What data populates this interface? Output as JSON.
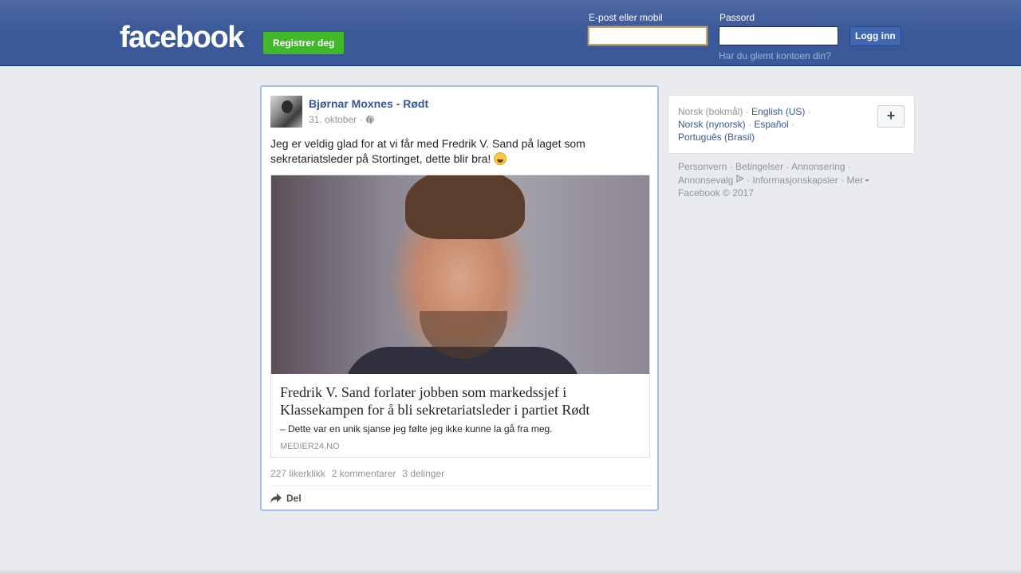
{
  "header": {
    "logo": "facebook",
    "register_label": "Registrer deg",
    "email_label": "E-post eller mobil",
    "email_value": "",
    "password_label": "Passord",
    "password_value": "",
    "login_label": "Logg inn",
    "forgot_label": "Har du glemt kontoen din?"
  },
  "post": {
    "author": "Bjørnar Moxnes - Rødt",
    "date": "31. oktober",
    "separator": "·",
    "text": "Jeg er veldig glad for at vi får med Fredrik V. Sand på laget som sekretariatsleder på Stortinget, dette blir bra!",
    "link": {
      "title": "Fredrik V. Sand forlater jobben som markedssjef i Klassekampen for å bli sekretariatsleder i partiet Rødt",
      "description": "– Dette var en unik sjanse jeg følte jeg ikke kunne la gå fra meg.",
      "domain": "MEDIER24.NO"
    },
    "likes": "227 likerklikk",
    "comments": "2 kommentarer",
    "shares": "3 delinger",
    "share_label": "Del"
  },
  "languages": {
    "current": "Norsk (bokmål)",
    "items": [
      "English (US)",
      "Norsk (nynorsk)",
      "Español",
      "Português (Brasil)"
    ],
    "add_label": "+"
  },
  "footer": {
    "links": [
      "Personvern",
      "Betingelser",
      "Annonsering",
      "Annonsevalg",
      "Informasjonskapsler",
      "Mer"
    ],
    "copyright": "Facebook © 2017"
  },
  "colors": {
    "brand": "#3b5998",
    "link": "#365899",
    "register": "#42b72a"
  }
}
